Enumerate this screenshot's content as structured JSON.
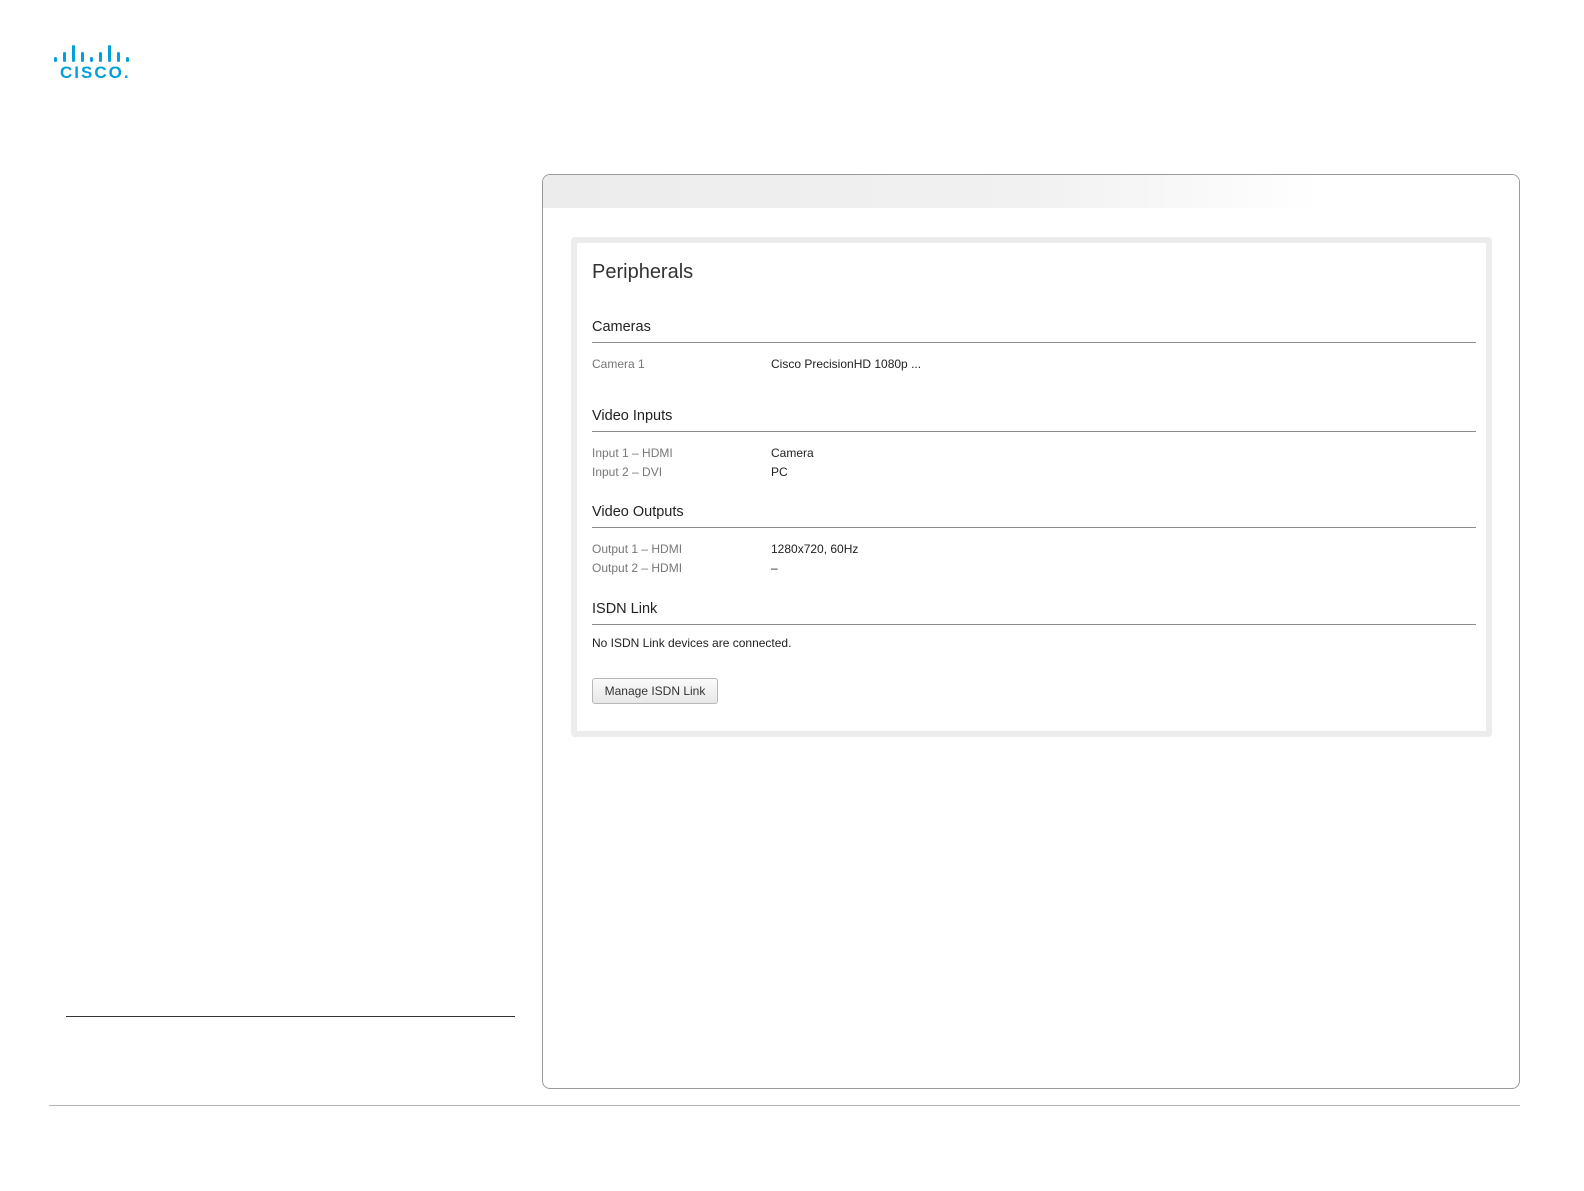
{
  "logo": {
    "wordmark": "CISCO."
  },
  "panel": {
    "title": "Peripherals",
    "sections": {
      "cameras": {
        "heading": "Cameras",
        "rows": [
          {
            "label": "Camera 1",
            "value": "Cisco PrecisionHD 1080p ..."
          }
        ]
      },
      "video_inputs": {
        "heading": "Video Inputs",
        "rows": [
          {
            "label": "Input 1 – HDMI",
            "value": "Camera"
          },
          {
            "label": "Input 2 – DVI",
            "value": "PC"
          }
        ]
      },
      "video_outputs": {
        "heading": "Video Outputs",
        "rows": [
          {
            "label": "Output 1 – HDMI",
            "value": "1280x720, 60Hz"
          },
          {
            "label": "Output 2 – HDMI",
            "value": "–"
          }
        ]
      },
      "isdn_link": {
        "heading": "ISDN Link",
        "message": "No ISDN Link devices are connected.",
        "button_label": "Manage ISDN Link"
      }
    }
  },
  "colors": {
    "brand": "#049fd9",
    "panel_border": "#ececec"
  }
}
